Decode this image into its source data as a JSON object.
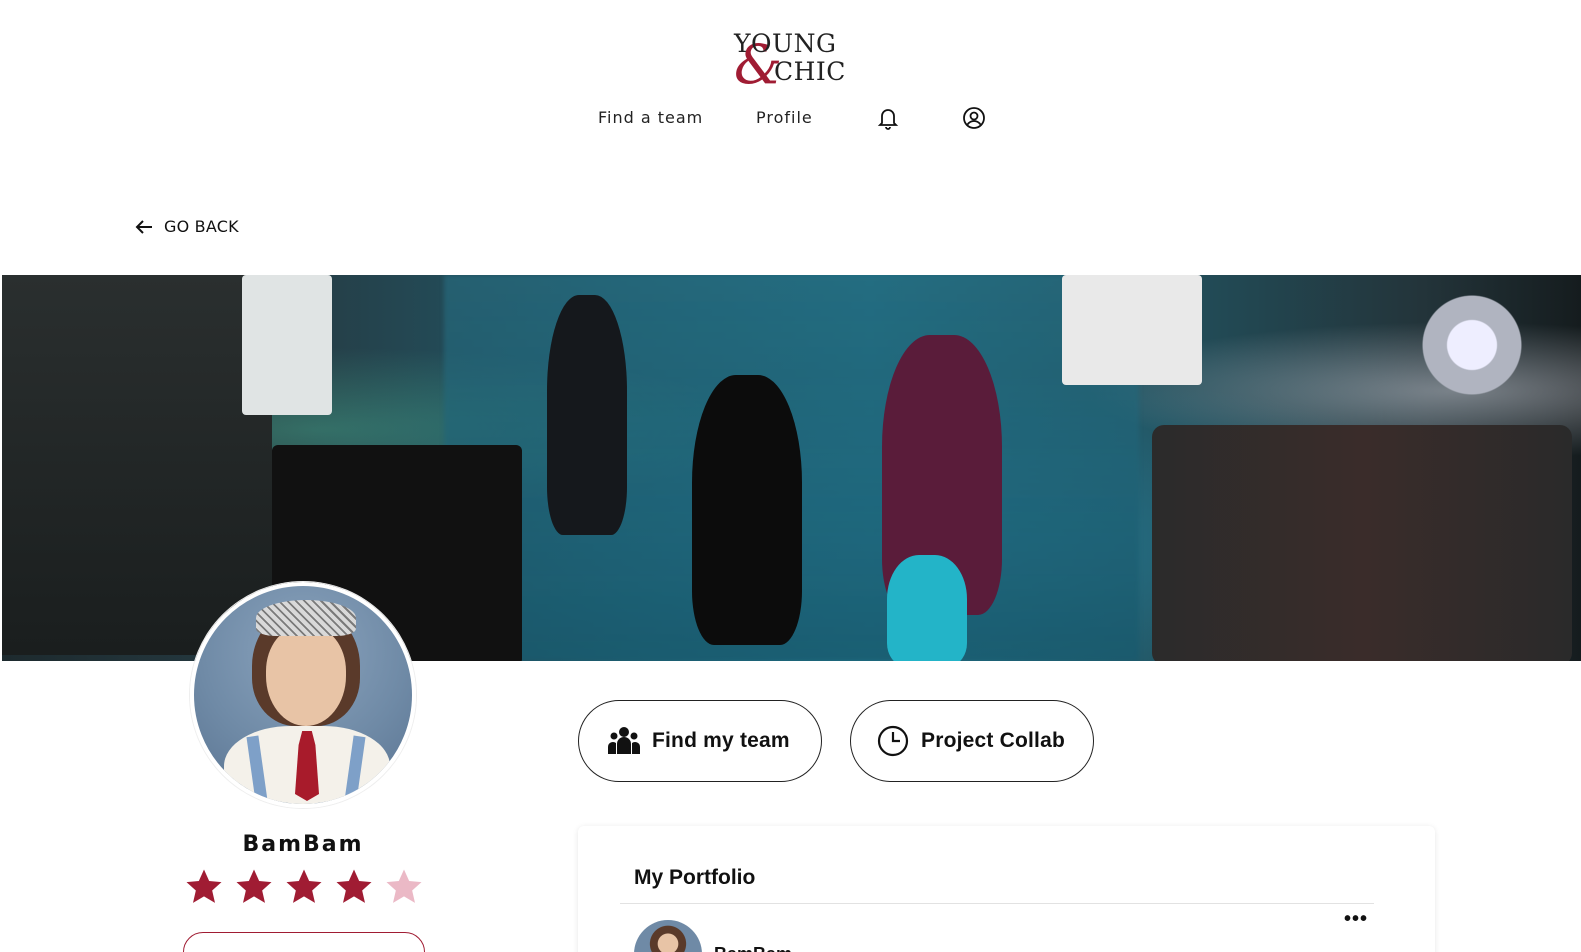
{
  "header": {
    "logo": {
      "line1": "YOUNG",
      "amp": "&",
      "line2": "CHIC"
    },
    "nav": {
      "find_team": "Find a team",
      "profile": "Profile"
    },
    "icons": {
      "notifications": "bell-icon",
      "account": "user-circle-icon"
    }
  },
  "goback": {
    "label": "GO BACK",
    "icon": "arrow-left-icon"
  },
  "banner": {
    "alt": "runway-photo"
  },
  "profile": {
    "name": "BamBam",
    "rating": 4,
    "rating_max": 5,
    "star_color_filled": "#a01c33",
    "star_color_empty": "#ebb9c6"
  },
  "actions": {
    "find_my_team": {
      "label": "Find my team",
      "icon": "team-icon"
    },
    "project_collab": {
      "label": "Project Collab",
      "icon": "clock-icon"
    }
  },
  "portfolio": {
    "title": "My Portfolio",
    "more": "•••",
    "author": "BamBam"
  },
  "colors": {
    "accent": "#a01c33",
    "text": "#111111",
    "border": "#222222"
  }
}
